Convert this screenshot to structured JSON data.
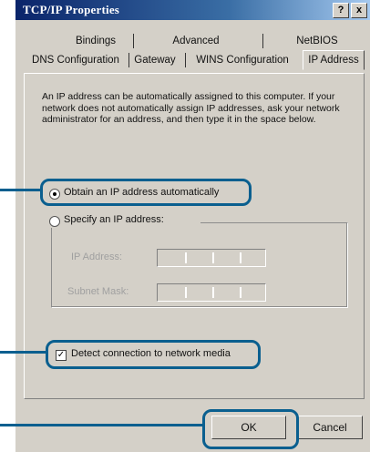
{
  "window": {
    "title": "TCP/IP Properties",
    "help_label": "?",
    "close_label": "x"
  },
  "tabs": {
    "row1": [
      "Bindings",
      "Advanced",
      "NetBIOS"
    ],
    "row2": [
      "DNS Configuration",
      "Gateway",
      "WINS Configuration",
      "IP Address"
    ],
    "active": "IP Address"
  },
  "description": "An IP address can be automatically assigned to this computer. If your network does not automatically assign IP addresses, ask your network administrator for an address, and then type it in the space below.",
  "options": {
    "obtain_auto": {
      "label": "Obtain an IP address automatically",
      "selected": true
    },
    "specify": {
      "label": "Specify an IP address:",
      "selected": false
    }
  },
  "fields": {
    "ip_address_label": "IP Address:",
    "subnet_mask_label": "Subnet Mask:"
  },
  "detect_media": {
    "label": "Detect connection to network media",
    "checked": true,
    "check_glyph": "✓"
  },
  "buttons": {
    "ok": "OK",
    "cancel": "Cancel"
  },
  "colors": {
    "callout": "#0a5f8f",
    "titlebar": "#0a246a"
  }
}
